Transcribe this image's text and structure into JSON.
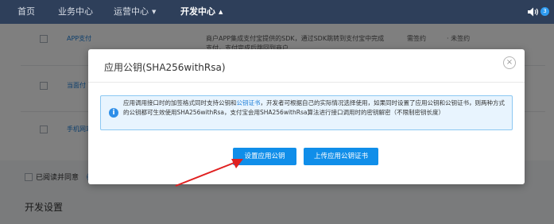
{
  "nav": {
    "home": "首页",
    "business": "业务中心",
    "operations": "运营中心",
    "developer": "开发中心",
    "badge_count": "3"
  },
  "table": {
    "rows": {
      "app_pay": {
        "link": "APP支付",
        "description": "商户APP集成支付宝提供的SDK，通过SDK跳转到支付宝中完成",
        "description_line2": "支付，支付完成后跳回到商户",
        "rate": "需签约",
        "status": "· 未签约"
      },
      "face_pay": {
        "link": "当面付"
      },
      "mobile_web": {
        "link": "手机网站"
      }
    }
  },
  "agreement": {
    "label": "已阅读并同意",
    "extra": "《"
  },
  "section": {
    "title": "开发设置"
  },
  "modal": {
    "title": "应用公钥(SHA256withRsa)",
    "close_glyph": "×",
    "notice_prefix": "应用调用接口时的加签格式同时支持公钥和",
    "notice_link": "公钥证书",
    "notice_suffix": "，开发者可根据自己的实际情况选择使用，如果同时设置了应用公钥和公钥证书，则两种方式的公钥都可生效使用SHA256withRsa，支付宝会用SHA256withRsa算法进行接口调用时的密钥解密（不限制密钥长度）",
    "info_glyph": "i",
    "set_key_button": "设置应用公钥",
    "upload_cert_button": "上传应用公钥证书"
  },
  "colors": {
    "nav_bg": "#2e3f5a",
    "primary": "#108ee9",
    "notice_bg": "#e8f4fe",
    "notice_border": "#8cc8f2",
    "annotation_arrow": "#e02020"
  },
  "icons": {
    "speaker": "speaker-icon",
    "close": "close-icon",
    "info": "info-icon",
    "caret": "caret-icon"
  }
}
